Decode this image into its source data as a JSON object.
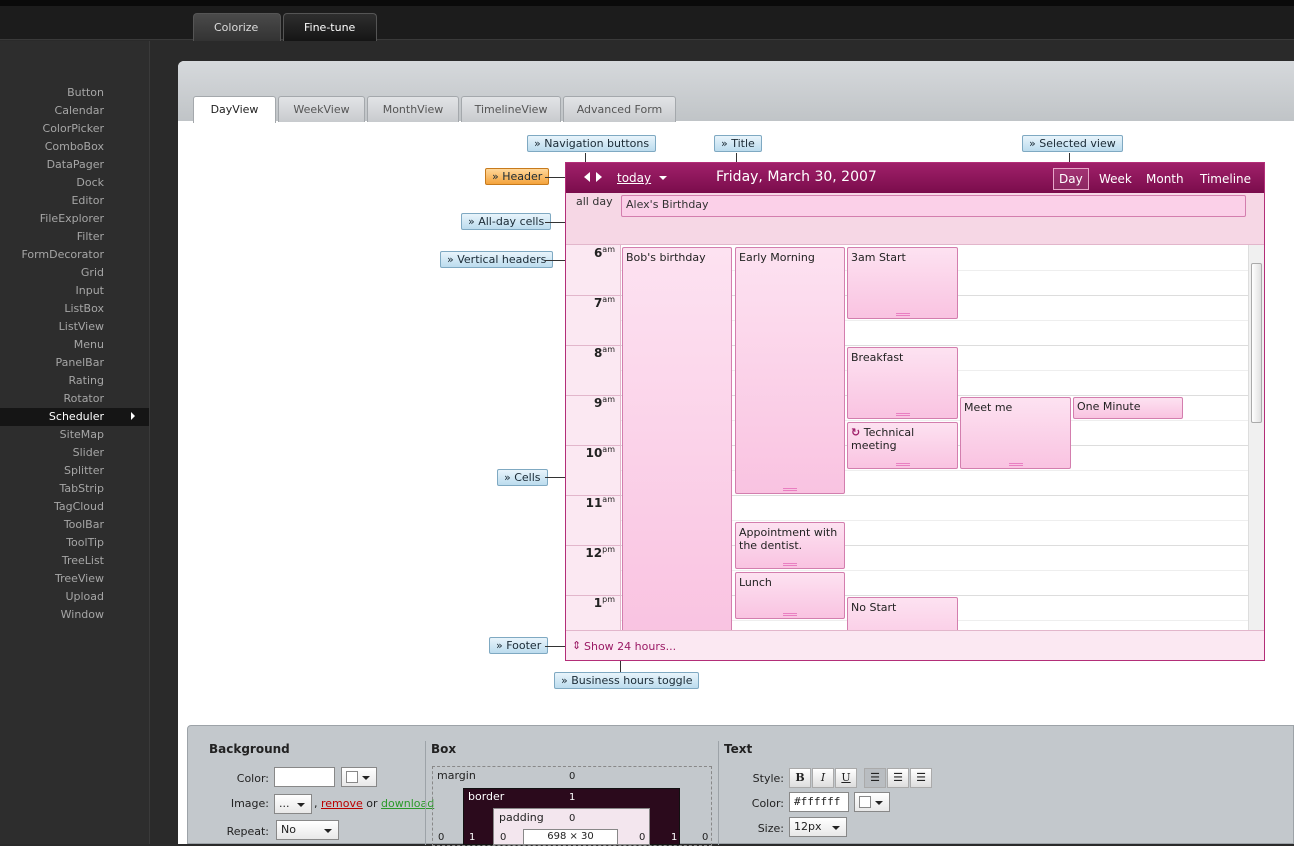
{
  "top_tabs": [
    "Colorize",
    "Fine-tune"
  ],
  "sidebar": [
    "Button",
    "Calendar",
    "ColorPicker",
    "ComboBox",
    "DataPager",
    "Dock",
    "Editor",
    "FileExplorer",
    "Filter",
    "FormDecorator",
    "Grid",
    "Input",
    "ListBox",
    "ListView",
    "Menu",
    "PanelBar",
    "Rating",
    "Rotator",
    "Scheduler",
    "SiteMap",
    "Slider",
    "Splitter",
    "TabStrip",
    "TagCloud",
    "ToolBar",
    "ToolTip",
    "TreeList",
    "TreeView",
    "Upload",
    "Window"
  ],
  "view_tabs": [
    "DayView",
    "WeekView",
    "MonthView",
    "TimelineView",
    "Advanced Form"
  ],
  "callouts": {
    "navigation": "» Navigation buttons",
    "title": "» Title",
    "selected_view": "» Selected view",
    "header": "» Header",
    "allday": "» All-day cells",
    "vheaders": "» Vertical headers",
    "cells": "» Cells",
    "footer": "» Footer",
    "bhtoggle": "» Business hours toggle"
  },
  "scheduler": {
    "today": "today",
    "title": "Friday, March 30, 2007",
    "views": [
      "Day",
      "Week",
      "Month",
      "Timeline"
    ],
    "allday_label": "all day",
    "allday_event": "Alex's Birthday",
    "hours": [
      {
        "h": "6",
        "s": "am"
      },
      {
        "h": "7",
        "s": "am"
      },
      {
        "h": "8",
        "s": "am"
      },
      {
        "h": "9",
        "s": "am"
      },
      {
        "h": "10",
        "s": "am"
      },
      {
        "h": "11",
        "s": "am"
      },
      {
        "h": "12",
        "s": "pm"
      },
      {
        "h": "1",
        "s": "pm"
      }
    ],
    "events": {
      "bob": "Bob's birthday",
      "early": "Early Morning",
      "start3": "3am Start",
      "breakfast": "Breakfast",
      "meet": "Meet me",
      "oneminute": "One Minute",
      "tech": "Technical meeting",
      "dentist": "Appointment with the dentist.",
      "lunch": "Lunch",
      "nostart": "No Start"
    },
    "footer": "Show 24 hours..."
  },
  "props": {
    "background": "Background",
    "box": "Box",
    "text": "Text",
    "color_label": "Color:",
    "image_label": "Image:",
    "repeat_label": "Repeat:",
    "repeat_value": "No",
    "image_btn": "...",
    "remove": "remove",
    "or": "or",
    "download": "download",
    "margin": "margin",
    "border": "border",
    "padding": "padding",
    "zero": "0",
    "one": "1",
    "size_readout": "698 × 30",
    "style_label": "Style:",
    "text_color_label": "Color:",
    "text_color_value": "#ffffff",
    "size_label": "Size:",
    "size_value": "12px",
    "bold": "B",
    "italic": "I",
    "underline": "U"
  }
}
